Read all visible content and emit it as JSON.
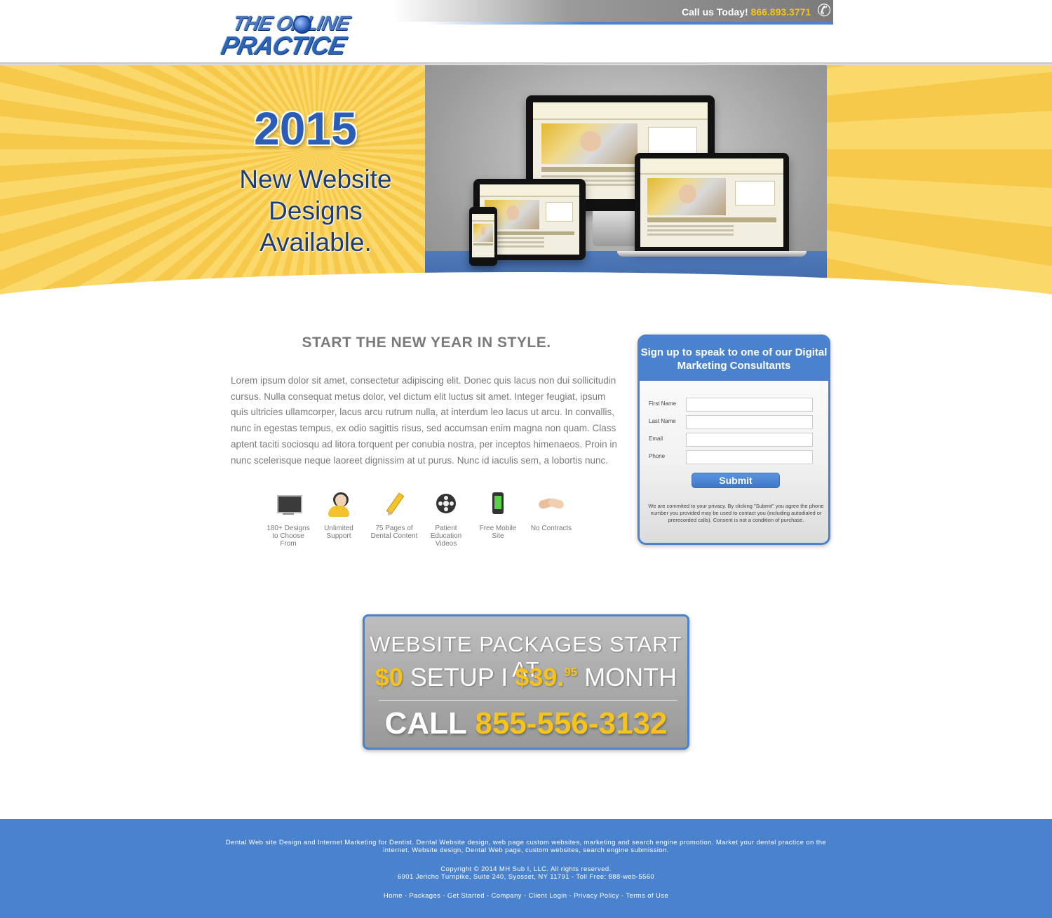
{
  "header": {
    "logo_line1": "THE ONLINE",
    "logo_line2": "PRACTICE",
    "call_label": "Call us Today!",
    "call_number": "866.893.3771"
  },
  "hero": {
    "year": "2015",
    "line1": "New Website",
    "line2": "Designs",
    "line3": "Available."
  },
  "content": {
    "title": "START THE NEW YEAR IN STYLE.",
    "intro": "Lorem ipsum dolor sit amet, consectetur adipiscing elit. Donec quis lacus non dui sollicitudin cursus. Nulla consequat metus dolor, vel dictum elit luctus sit amet. Integer feugiat, ipsum quis ultricies ullamcorper, lacus arcu rutrum nulla, at interdum leo lacus ut arcu. In convallis, nunc in egestas tempus, ex odio sagittis risus, sed accumsan enim magna non quam. Class aptent taciti sociosqu ad litora torquent per conubia nostra, per inceptos himenaeos. Proin in nunc scelerisque neque laoreet dignissim at ut purus. Nunc id iaculis sem, a lobortis nunc.",
    "features": [
      {
        "icon": "monitor-icon",
        "label": "180+ Designs to Choose From"
      },
      {
        "icon": "support-person-icon",
        "label": "Unlimited Support"
      },
      {
        "icon": "pencil-icon",
        "label": "75 Pages of Dental Content"
      },
      {
        "icon": "film-reel-icon",
        "label": "Patient Education Videos"
      },
      {
        "icon": "mobile-phone-icon",
        "label": "Free Mobile Site"
      },
      {
        "icon": "handshake-icon",
        "label": "No Contracts"
      }
    ]
  },
  "form": {
    "heading": "Sign up to speak to one of our Digital Marketing Consultants",
    "fields": [
      {
        "label": "First Name",
        "value": ""
      },
      {
        "label": "Last Name",
        "value": ""
      },
      {
        "label": "Email",
        "value": ""
      },
      {
        "label": "Phone",
        "value": ""
      }
    ],
    "submit_label": "Submit",
    "privacy": "We are commited to your privacy. By clicking \"Submit\" you agree the phone number you provided may be used to contact you (including autodialed or prerecorded calls). Consent is not a condition of purchase."
  },
  "promo": {
    "line1": "WEBSITE PACKAGES START AT",
    "setup_price": "$0",
    "setup_label": "SETUP",
    "separator": "I",
    "month_price": "$39.",
    "month_cents": "95",
    "month_label": "MONTH",
    "call_label": "CALL",
    "call_number": "855-556-3132"
  },
  "footer": {
    "description": "Dental Web site Design and Internet Marketing for Dentist. Dental Website design, web page custom websites, marketing and search engine promotion. Market your dental practice on the internet. Website design, Dental Web page, custom websites, search engine submission.",
    "copyright": "Copyright © 2014 MH Sub I, LLC. All rights reserved.",
    "address": "6901 Jericho Turnpike, Suite 240, Syosset, NY 11791 - Toll Free: 888-web-5560",
    "links": [
      "Home",
      "Packages",
      "Get Started",
      "Company",
      "Client Login",
      "Privacy Policy",
      "Terms of Use"
    ]
  },
  "colors": {
    "brand_blue": "#4a82cd",
    "accent_gold": "#f6c21c",
    "hero_yellow": "#f7c94a"
  }
}
